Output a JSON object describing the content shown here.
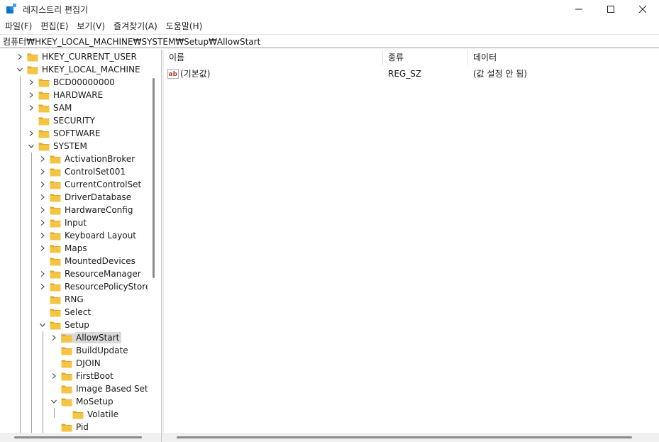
{
  "window": {
    "title": "레지스트리 편집기",
    "controls": [
      "minimize-icon",
      "maximize-icon",
      "close-icon"
    ]
  },
  "menu": [
    {
      "label": "파일(F)"
    },
    {
      "label": "편집(E)"
    },
    {
      "label": "보기(V)"
    },
    {
      "label": "즐겨찾기(A)"
    },
    {
      "label": "도움말(H)"
    }
  ],
  "address": {
    "path": "컴퓨터₩HKEY_LOCAL_MACHINE₩SYSTEM₩Setup₩AllowStart"
  },
  "tree": [
    {
      "label": "HKEY_CURRENT_USER",
      "level": 1,
      "expander": "collapsed"
    },
    {
      "label": "HKEY_LOCAL_MACHINE",
      "level": 1,
      "expander": "expanded"
    },
    {
      "label": "BCD00000000",
      "level": 2,
      "expander": "collapsed"
    },
    {
      "label": "HARDWARE",
      "level": 2,
      "expander": "collapsed"
    },
    {
      "label": "SAM",
      "level": 2,
      "expander": "collapsed"
    },
    {
      "label": "SECURITY",
      "level": 2,
      "expander": "none"
    },
    {
      "label": "SOFTWARE",
      "level": 2,
      "expander": "collapsed"
    },
    {
      "label": "SYSTEM",
      "level": 2,
      "expander": "expanded"
    },
    {
      "label": "ActivationBroker",
      "level": 3,
      "expander": "collapsed"
    },
    {
      "label": "ControlSet001",
      "level": 3,
      "expander": "collapsed"
    },
    {
      "label": "CurrentControlSet",
      "level": 3,
      "expander": "collapsed"
    },
    {
      "label": "DriverDatabase",
      "level": 3,
      "expander": "collapsed"
    },
    {
      "label": "HardwareConfig",
      "level": 3,
      "expander": "collapsed"
    },
    {
      "label": "Input",
      "level": 3,
      "expander": "collapsed"
    },
    {
      "label": "Keyboard Layout",
      "level": 3,
      "expander": "collapsed"
    },
    {
      "label": "Maps",
      "level": 3,
      "expander": "collapsed"
    },
    {
      "label": "MountedDevices",
      "level": 3,
      "expander": "none"
    },
    {
      "label": "ResourceManager",
      "level": 3,
      "expander": "collapsed"
    },
    {
      "label": "ResourcePolicyStore",
      "level": 3,
      "expander": "collapsed"
    },
    {
      "label": "RNG",
      "level": 3,
      "expander": "none"
    },
    {
      "label": "Select",
      "level": 3,
      "expander": "none"
    },
    {
      "label": "Setup",
      "level": 3,
      "expander": "expanded"
    },
    {
      "label": "AllowStart",
      "level": 4,
      "expander": "collapsed",
      "selected": true
    },
    {
      "label": "BuildUpdate",
      "level": 4,
      "expander": "none"
    },
    {
      "label": "DJOIN",
      "level": 4,
      "expander": "none"
    },
    {
      "label": "FirstBoot",
      "level": 4,
      "expander": "collapsed"
    },
    {
      "label": "Image Based Setup",
      "level": 4,
      "expander": "none"
    },
    {
      "label": "MoSetup",
      "level": 4,
      "expander": "expanded"
    },
    {
      "label": "Volatile",
      "level": 5,
      "expander": "none"
    },
    {
      "label": "Pid",
      "level": 4,
      "expander": "none"
    }
  ],
  "list": {
    "columns": {
      "name": "이름",
      "type": "종류",
      "data": "데이터"
    },
    "rows": [
      {
        "icon": "string-value-icon",
        "name": "(기본값)",
        "type": "REG_SZ",
        "data": "(값 설정 안 됨)"
      }
    ]
  },
  "colors": {
    "folder": "#f4c542",
    "folder_dark": "#e0a826",
    "selection": "#d9d9d9",
    "accent": "#0067c0"
  }
}
